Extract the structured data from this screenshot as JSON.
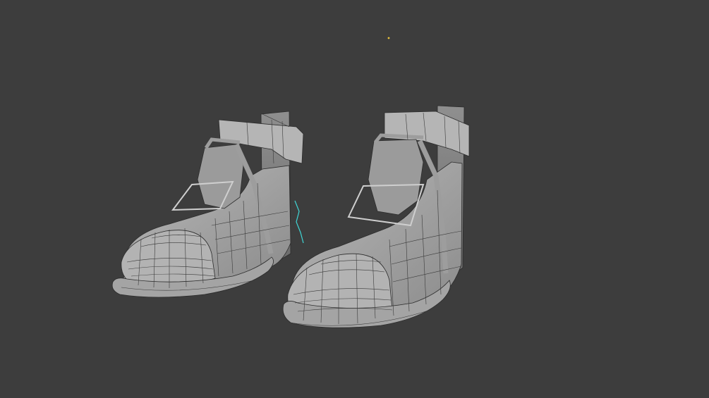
{
  "viewport": {
    "background_color": "#3d3d3d",
    "mesh_color": "#a9a9a9",
    "wire_color": "#2c2c2c",
    "selection_color": "#3fd6d6",
    "origin_color": "#e8c23a"
  },
  "scene": {
    "objects": [
      {
        "name_icon": "boot-mesh-left"
      },
      {
        "name_icon": "boot-mesh-right"
      }
    ]
  }
}
